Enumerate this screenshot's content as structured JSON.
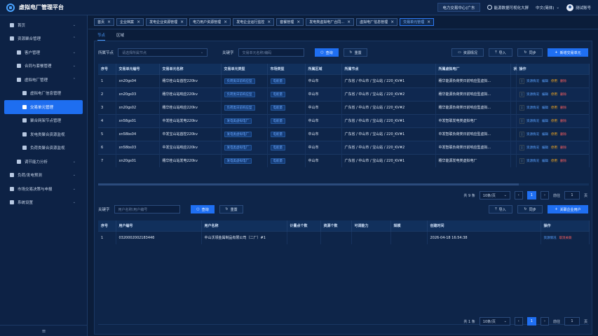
{
  "app": {
    "title": "虚拟电厂管理平台"
  },
  "topbar": {
    "org": "电力交易中心(广东",
    "dashboard": "能源数据可视化大屏",
    "lang": "中文(简体)",
    "user": "测试账号"
  },
  "sidebar": {
    "items": [
      {
        "label": "首页",
        "level": 0,
        "chev": "⌄"
      },
      {
        "label": "资源聚合管理",
        "level": 0,
        "chev": "⌃"
      },
      {
        "label": "客户管理",
        "level": 1,
        "chev": "⌄"
      },
      {
        "label": "合同与套餐管理",
        "level": 1,
        "chev": "⌄"
      },
      {
        "label": "虚拟电厂管理",
        "level": 1,
        "chev": "⌃"
      },
      {
        "label": "虚拟电厂信息管理",
        "level": 2,
        "chev": ""
      },
      {
        "label": "交易单元管理",
        "level": 2,
        "chev": "",
        "active": true
      },
      {
        "label": "聚合网架节点管理",
        "level": 2,
        "chev": ""
      },
      {
        "label": "发电类聚合资源监视",
        "level": 2,
        "chev": ""
      },
      {
        "label": "负荷类聚合资源监视",
        "level": 2,
        "chev": ""
      },
      {
        "label": "调节能力分析",
        "level": 1,
        "chev": "⌄"
      },
      {
        "label": "负荷/发电预测",
        "level": 0,
        "chev": "⌄"
      },
      {
        "label": "市场交易决策与申报",
        "level": 0,
        "chev": "⌄"
      },
      {
        "label": "系统设置",
        "level": 0,
        "chev": "⌄"
      }
    ],
    "collapse": "≡"
  },
  "tabs": [
    {
      "label": "首页"
    },
    {
      "label": "企业档案"
    },
    {
      "label": "发电企业资源管理"
    },
    {
      "label": "电力用户资源管理"
    },
    {
      "label": "发电企业运行监控"
    },
    {
      "label": "套餐管理"
    },
    {
      "label": "发电类虚拟电厂合同..."
    },
    {
      "label": "虚拟电厂信息管理"
    },
    {
      "label": "交易单元管理",
      "active": true
    }
  ],
  "subtabs": {
    "node": "节点",
    "area": "区域"
  },
  "filter": {
    "node_label": "所属节点",
    "node_placeholder": "请选择所属节点",
    "kw_label": "关键字",
    "kw_placeholder": "交易单元名称/编码",
    "query": "查询",
    "reset": "重置",
    "resource": "资源情况",
    "import": "导入",
    "sync": "同步",
    "add": "新增交易单元"
  },
  "unit_table": {
    "headers": [
      "序号",
      "交易单元编号",
      "交易单元名称",
      "交易单元类型",
      "市场类型",
      "所属区域",
      "所属节点",
      "所属虚拟电厂",
      "状",
      "操作"
    ],
    "rows": [
      {
        "no": "1",
        "code": "xn20gs04",
        "name": "穗华桂山岛首控220kv",
        "type": "负荷类日前响应型",
        "market": "电能量",
        "area": "中山市",
        "node": "广东省 / 中山市 / 宝山站 / 220_KV#1",
        "vpp": "穗华能源负荷类日前响应型虚拟..."
      },
      {
        "no": "2",
        "code": "xn20gs03",
        "name": "穗华桂山站响应220kv",
        "type": "负荷类日前响应型",
        "market": "电能量",
        "area": "中山市",
        "node": "广东省 / 中山市 / 宝山站 / 220_KV#2",
        "vpp": "穗华能源负荷类日前响应型虚拟..."
      },
      {
        "no": "3",
        "code": "xn20gs02",
        "name": "穗华桂山站响应220kv",
        "type": "负荷类日前响应型",
        "market": "电能量",
        "area": "中山市",
        "node": "广东省 / 中山市 / 宝山站 / 220_KV#2",
        "vpp": "穗华能源负荷类日前响应型虚拟..."
      },
      {
        "no": "4",
        "code": "xn58gs01",
        "name": "中发桂山站发电220kv",
        "type": "发电类虚拟电厂",
        "market": "电能量",
        "area": "中山市",
        "node": "广东省 / 中山市 / 宝山站 / 220_KV#1",
        "vpp": "中发智联发电类虚拟电厂"
      },
      {
        "no": "5",
        "code": "xn58bs04",
        "name": "中发宝山站首控220kv",
        "type": "发电类虚拟电厂",
        "market": "电能量",
        "area": "中山市",
        "node": "广东省 / 中山市 / 宝山站 / 220_KV#1",
        "vpp": "中发智联负荷类日前响应型虚拟..."
      },
      {
        "no": "6",
        "code": "xn58bs03",
        "name": "中发宝山站响应220kv",
        "type": "发电类虚拟电厂",
        "market": "电能量",
        "area": "中山市",
        "node": "广东省 / 中山市 / 宝山站 / 220_KV#2",
        "vpp": "中发智联负荷类日前响应型虚拟..."
      },
      {
        "no": "7",
        "code": "xn20gs01",
        "name": "穗华桂山站发电220kv",
        "type": "发电类虚拟电厂",
        "market": "电能量",
        "area": "中山市",
        "node": "广东省 / 中山市 / 宝山站 / 220_KV#1",
        "vpp": "穗华能源发电类虚拟电厂"
      }
    ],
    "ops": {
      "box": "|",
      "resource": "资源情况",
      "edit": "编辑",
      "disable": "停用",
      "delete": "删除"
    }
  },
  "pager1": {
    "total": "共 9 条",
    "size": "10条/页",
    "page": "1",
    "goto": "前往",
    "goto_val": "1",
    "unit": "页"
  },
  "user_filter": {
    "kw_label": "关键字",
    "kw_placeholder": "用户名称/用户编号",
    "query": "查询",
    "reset": "重置",
    "import": "导入",
    "sync": "同步",
    "add": "关联企业用户"
  },
  "user_table": {
    "headers": [
      "序号",
      "用户编号",
      "用户名称",
      "计量点个数",
      "资源个数",
      "可调能力",
      "规模",
      "创建时间",
      "操作"
    ],
    "rows": [
      {
        "no": "1",
        "code": "032000200218344б",
        "name": "中山沃领金属制品有限公司（二厂）#1",
        "meter": "",
        "res": "",
        "cap": "",
        "scale": "",
        "created": "2026-04-18 16:54:38",
        "op1": "资源情况",
        "op2": "取消关联"
      }
    ]
  },
  "pager2": {
    "total": "共 1 条",
    "size": "10条/页",
    "page": "1",
    "goto": "前往",
    "goto_val": "1",
    "unit": "页"
  }
}
